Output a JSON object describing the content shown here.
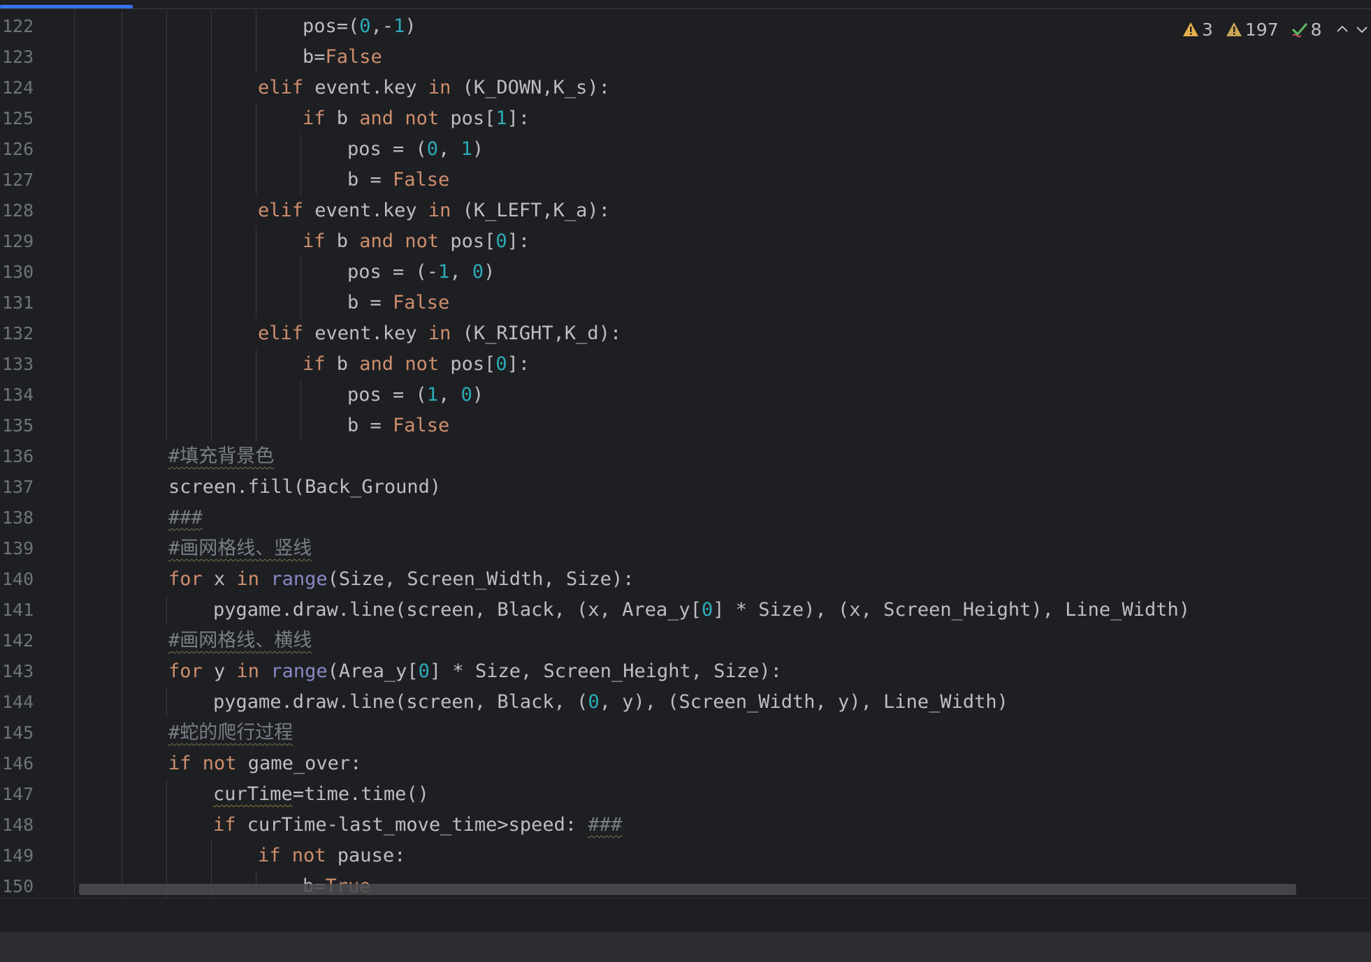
{
  "inspections": {
    "errors_count": "3",
    "warnings_count": "197",
    "typos_count": "8"
  },
  "lines": [
    {
      "n": "122",
      "indent": 5,
      "tokens": [
        [
          "t",
          "pos="
        ],
        [
          "n",
          "0"
        ],
        [
          "t",
          ","
        ],
        [
          "t",
          "-"
        ],
        [
          "n",
          "1"
        ],
        [
          "t",
          ")"
        ]
      ],
      "text_prefix": "pos=(",
      "prefix_done": true
    },
    {
      "n": "123",
      "indent": 5,
      "tokens": [
        [
          "t",
          "b="
        ],
        [
          "k",
          "False"
        ]
      ]
    },
    {
      "n": "124",
      "indent": 4,
      "tokens": [
        [
          "k",
          "elif "
        ],
        [
          "t",
          "event.key "
        ],
        [
          "k",
          "in "
        ],
        [
          "t",
          "(K_DOWN,K_s):"
        ]
      ]
    },
    {
      "n": "125",
      "indent": 5,
      "tokens": [
        [
          "k",
          "if "
        ],
        [
          "t",
          "b "
        ],
        [
          "k",
          "and not "
        ],
        [
          "t",
          "pos["
        ],
        [
          "n",
          "1"
        ],
        [
          "t",
          "]:"
        ]
      ]
    },
    {
      "n": "126",
      "indent": 6,
      "tokens": [
        [
          "t",
          "pos = ("
        ],
        [
          "n",
          "0"
        ],
        [
          "t",
          ", "
        ],
        [
          "n",
          "1"
        ],
        [
          "t",
          ")"
        ]
      ]
    },
    {
      "n": "127",
      "indent": 6,
      "tokens": [
        [
          "t",
          "b = "
        ],
        [
          "k",
          "False"
        ]
      ]
    },
    {
      "n": "128",
      "indent": 4,
      "tokens": [
        [
          "k",
          "elif "
        ],
        [
          "t",
          "event.key "
        ],
        [
          "k",
          "in "
        ],
        [
          "t",
          "(K_LEFT,K_a):"
        ]
      ]
    },
    {
      "n": "129",
      "indent": 5,
      "tokens": [
        [
          "k",
          "if "
        ],
        [
          "t",
          "b "
        ],
        [
          "k",
          "and not "
        ],
        [
          "t",
          "pos["
        ],
        [
          "n",
          "0"
        ],
        [
          "t",
          "]:"
        ]
      ]
    },
    {
      "n": "130",
      "indent": 6,
      "tokens": [
        [
          "t",
          "pos = (-"
        ],
        [
          "n",
          "1"
        ],
        [
          "t",
          ", "
        ],
        [
          "n",
          "0"
        ],
        [
          "t",
          ")"
        ]
      ]
    },
    {
      "n": "131",
      "indent": 6,
      "tokens": [
        [
          "t",
          "b = "
        ],
        [
          "k",
          "False"
        ]
      ]
    },
    {
      "n": "132",
      "indent": 4,
      "tokens": [
        [
          "k",
          "elif "
        ],
        [
          "t",
          "event.key "
        ],
        [
          "k",
          "in "
        ],
        [
          "t",
          "(K_RIGHT,K_d):"
        ]
      ]
    },
    {
      "n": "133",
      "indent": 5,
      "tokens": [
        [
          "k",
          "if "
        ],
        [
          "t",
          "b "
        ],
        [
          "k",
          "and not "
        ],
        [
          "t",
          "pos["
        ],
        [
          "n",
          "0"
        ],
        [
          "t",
          "]:"
        ]
      ]
    },
    {
      "n": "134",
      "indent": 6,
      "tokens": [
        [
          "t",
          "pos = ("
        ],
        [
          "n",
          "1"
        ],
        [
          "t",
          ", "
        ],
        [
          "n",
          "0"
        ],
        [
          "t",
          ")"
        ]
      ]
    },
    {
      "n": "135",
      "indent": 6,
      "tokens": [
        [
          "t",
          "b = "
        ],
        [
          "k",
          "False"
        ]
      ]
    },
    {
      "n": "136",
      "indent": 2,
      "tokens": [
        [
          "c",
          "#填充背景色"
        ]
      ]
    },
    {
      "n": "137",
      "indent": 2,
      "tokens": [
        [
          "t",
          "screen.fill(Back_Ground)"
        ]
      ]
    },
    {
      "n": "138",
      "indent": 2,
      "tokens": [
        [
          "g",
          "###"
        ]
      ]
    },
    {
      "n": "139",
      "indent": 2,
      "tokens": [
        [
          "c",
          "#画网格线、竖线"
        ]
      ]
    },
    {
      "n": "140",
      "indent": 2,
      "tokens": [
        [
          "k",
          "for "
        ],
        [
          "t",
          "x "
        ],
        [
          "k",
          "in "
        ],
        [
          "b",
          "range"
        ],
        [
          "t",
          "(Size, Screen_Width, Size):"
        ]
      ]
    },
    {
      "n": "141",
      "indent": 3,
      "tokens": [
        [
          "t",
          "pygame.draw.line(screen, Black, (x, Area_y["
        ],
        [
          "n",
          "0"
        ],
        [
          "t",
          "] * Size), (x, Screen_Height), Line_Width)"
        ]
      ]
    },
    {
      "n": "142",
      "indent": 2,
      "tokens": [
        [
          "c",
          "#画网格线、横线"
        ]
      ]
    },
    {
      "n": "143",
      "indent": 2,
      "tokens": [
        [
          "k",
          "for "
        ],
        [
          "t",
          "y "
        ],
        [
          "k",
          "in "
        ],
        [
          "b",
          "range"
        ],
        [
          "t",
          "(Area_y["
        ],
        [
          "n",
          "0"
        ],
        [
          "t",
          "] * Size, Screen_Height, Size):"
        ]
      ]
    },
    {
      "n": "144",
      "indent": 3,
      "tokens": [
        [
          "t",
          "pygame.draw.line(screen, Black, ("
        ],
        [
          "n",
          "0"
        ],
        [
          "t",
          ", y), (Screen_Width, y), Line_Width)"
        ]
      ]
    },
    {
      "n": "145",
      "indent": 2,
      "tokens": [
        [
          "c",
          "#蛇的爬行过程"
        ]
      ]
    },
    {
      "n": "146",
      "indent": 2,
      "tokens": [
        [
          "k",
          "if not "
        ],
        [
          "t",
          "game_over:"
        ]
      ]
    },
    {
      "n": "147",
      "indent": 3,
      "tokens": [
        [
          "y",
          "curTime"
        ],
        [
          "t",
          "=time.time()"
        ]
      ]
    },
    {
      "n": "148",
      "indent": 3,
      "tokens": [
        [
          "k",
          "if "
        ],
        [
          "t",
          "curTime-last_move_time>speed: "
        ],
        [
          "c",
          "###"
        ]
      ]
    },
    {
      "n": "149",
      "indent": 4,
      "tokens": [
        [
          "k",
          "if not "
        ],
        [
          "t",
          "pause:"
        ]
      ]
    },
    {
      "n": "150",
      "indent": 5,
      "tokens": [
        [
          "t",
          "b="
        ],
        [
          "k",
          "True"
        ]
      ]
    }
  ],
  "colors": {
    "keyword": "#cf8e6d",
    "number": "#2aacb8",
    "builtin": "#8888c6",
    "comment": "#7a7e85",
    "text": "#bcbec4",
    "background": "#1e1f22"
  }
}
